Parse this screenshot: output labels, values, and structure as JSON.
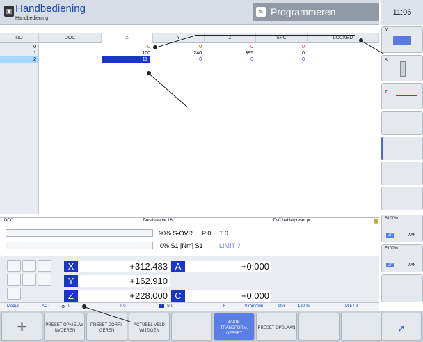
{
  "header": {
    "mode_title": "Handbediening",
    "mode_sub": "Handbediening",
    "prog_mode": "Programmeren",
    "clock": "11:06"
  },
  "table": {
    "columns": [
      "NO",
      "DOC",
      "X",
      "Y",
      "Z",
      "SPC",
      "LOCKED"
    ],
    "rows": [
      {
        "no": "0",
        "x": "0",
        "y": "0",
        "z": "0",
        "spc": "0"
      },
      {
        "no": "1",
        "x": "100",
        "y": "240",
        "z": "395",
        "spc": "0"
      },
      {
        "no": "2",
        "x": "11",
        "y": "0",
        "z": "0",
        "spc": "0"
      }
    ]
  },
  "docbar": {
    "label": "DOC",
    "width": "Tekstbreedte 16",
    "path": "TNC:\\table\\preset.pr"
  },
  "overrides": {
    "line1": "90% S-OVR",
    "p": "P 0",
    "t": "T 0",
    "line2": "0% S1  [Nm]  S1",
    "limit": "LIMIT ?"
  },
  "positions": [
    {
      "axis": "X",
      "value": "+312.483"
    },
    {
      "axis": "Y",
      "value": "+162.910"
    },
    {
      "axis": "Z",
      "value": "+228.000"
    }
  ],
  "positions_right": [
    {
      "axis": "A",
      "value": "+0.000"
    },
    {
      "axis": "C",
      "value": "+0.000"
    }
  ],
  "status": {
    "modus": "Modus",
    "act": "ACT",
    "preset": "0",
    "t": "T 0",
    "z": "Z",
    "s": "S 0",
    "f": "F",
    "feed": "0 mm/min",
    "ovr": "Ovr",
    "ovr_val": "120 %",
    "m": "M 5 / 9"
  },
  "right_keys": {
    "m_label": "M",
    "s_label": "S",
    "t_label": "T",
    "s100": "S100%",
    "f100": "F100%",
    "uit1": "UIT",
    "aan1": "AAN",
    "uit2": "UIT",
    "aan2": "AAN"
  },
  "softkeys": [
    "PRESET OPNIEUW INVOEREN",
    "PRESET CORRI-GEREN",
    "ACTUEEL VELD WIJZIGEN",
    "BASIS-TRANSFORM. OFFSET",
    "PRESET OPSLAAN"
  ],
  "colors": {
    "accent": "#1a35c9",
    "value_red": "#e02020",
    "value_blue": "#2a3cff"
  }
}
